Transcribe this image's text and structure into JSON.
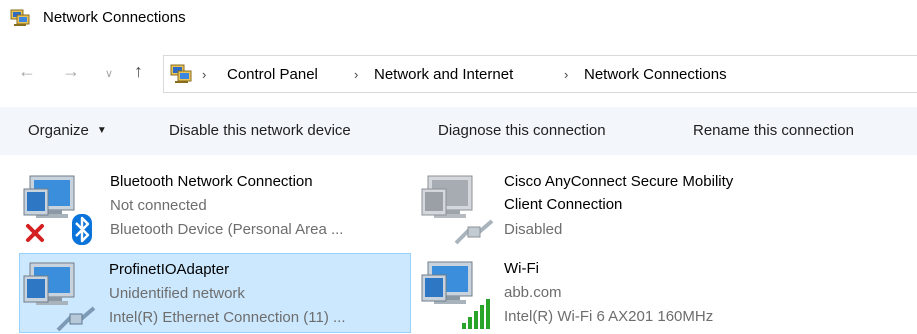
{
  "window": {
    "title": "Network Connections"
  },
  "nav": {
    "back_glyph": "←",
    "forward_glyph": "→",
    "recent_glyph": "∨",
    "up_glyph": "↑",
    "separator_glyph": "›"
  },
  "breadcrumb": [
    "Control Panel",
    "Network and Internet",
    "Network Connections"
  ],
  "toolbar": {
    "organize": "Organize",
    "disable": "Disable this network device",
    "diagnose": "Diagnose this connection",
    "rename": "Rename this connection"
  },
  "connections": [
    {
      "name": "Bluetooth Network Connection",
      "status": "Not connected",
      "device": "Bluetooth Device (Personal Area ...",
      "icon": "bluetooth-network-icon",
      "badge": "red-x-icon",
      "selected": false
    },
    {
      "name_line1": "Cisco AnyConnect Secure Mobility",
      "name_line2": "Client Connection",
      "status": "Disabled",
      "icon": "disabled-network-icon",
      "selected": false
    },
    {
      "name": "ProfinetIOAdapter",
      "status": "Unidentified network",
      "device": "Intel(R) Ethernet Connection (11) ...",
      "icon": "ethernet-network-icon",
      "selected": true
    },
    {
      "name": "Wi-Fi",
      "status": "abb.com",
      "device": "Intel(R) Wi-Fi 6 AX201 160MHz",
      "icon": "wifi-network-icon",
      "selected": false
    }
  ],
  "colors": {
    "selection_bg": "#cce8ff",
    "selection_border": "#99d1ff",
    "toolbar_bg": "#f3f6fb",
    "secondary_text": "#6d6d6d",
    "bluetooth_blue": "#0a74da",
    "error_red": "#d42020",
    "signal_green": "#2aa52a"
  }
}
